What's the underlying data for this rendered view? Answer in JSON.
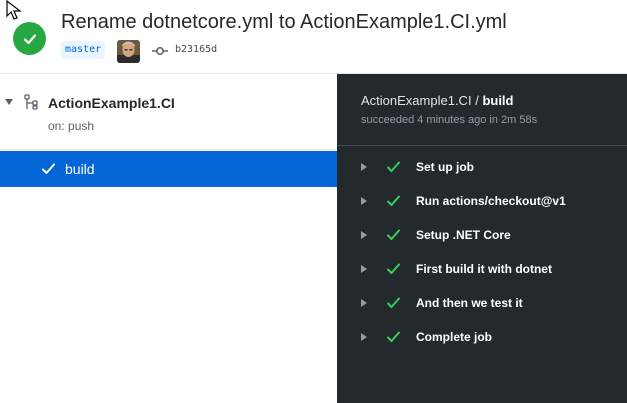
{
  "header": {
    "title": "Rename dotnetcore.yml to ActionExample1.CI.yml",
    "branch": "master",
    "commit_sha": "b23165d",
    "status": "success",
    "status_color": "#28a745"
  },
  "sidebar": {
    "workflow_name": "ActionExample1.CI",
    "trigger": "on: push",
    "jobs": [
      {
        "label": "build",
        "status": "success",
        "selected": true
      }
    ]
  },
  "job_panel": {
    "workflow": "ActionExample1.CI",
    "separator": "/",
    "job": "build",
    "summary": "succeeded 4 minutes ago in 2m 58s",
    "steps": [
      {
        "label": "Set up job",
        "status": "success"
      },
      {
        "label": "Run actions/checkout@v1",
        "status": "success"
      },
      {
        "label": "Setup .NET Core",
        "status": "success"
      },
      {
        "label": "First build it with dotnet",
        "status": "success"
      },
      {
        "label": "And then we test it",
        "status": "success"
      },
      {
        "label": "Complete job",
        "status": "success"
      }
    ]
  },
  "colors": {
    "accent": "#0366d6",
    "success": "#28a745",
    "panel_bg": "#24292e"
  },
  "icons": [
    "mouse-pointer-icon",
    "check-circle-icon",
    "git-commit-icon",
    "workflow-icon",
    "caret-down-icon",
    "caret-right-icon",
    "check-icon"
  ]
}
